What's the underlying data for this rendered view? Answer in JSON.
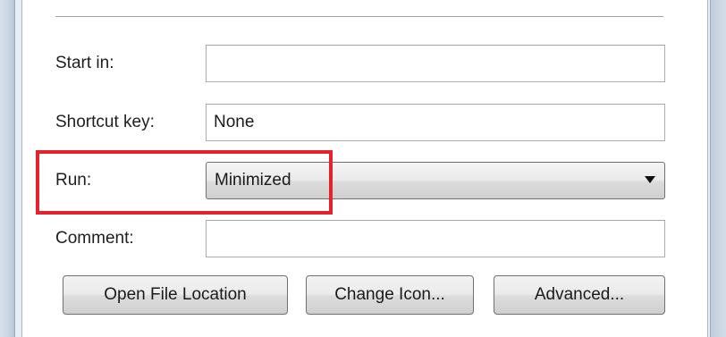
{
  "fields": {
    "start_in": {
      "label": "Start in:",
      "value": ""
    },
    "shortcut_key": {
      "label": "Shortcut key:",
      "value": "None"
    },
    "run": {
      "label": "Run:",
      "selected": "Minimized"
    },
    "comment": {
      "label": "Comment:",
      "value": ""
    }
  },
  "buttons": {
    "open_file_location": "Open File Location",
    "change_icon": "Change Icon...",
    "advanced": "Advanced..."
  },
  "colors": {
    "highlight": "#e3232c",
    "frame": "#c9d6e4"
  }
}
